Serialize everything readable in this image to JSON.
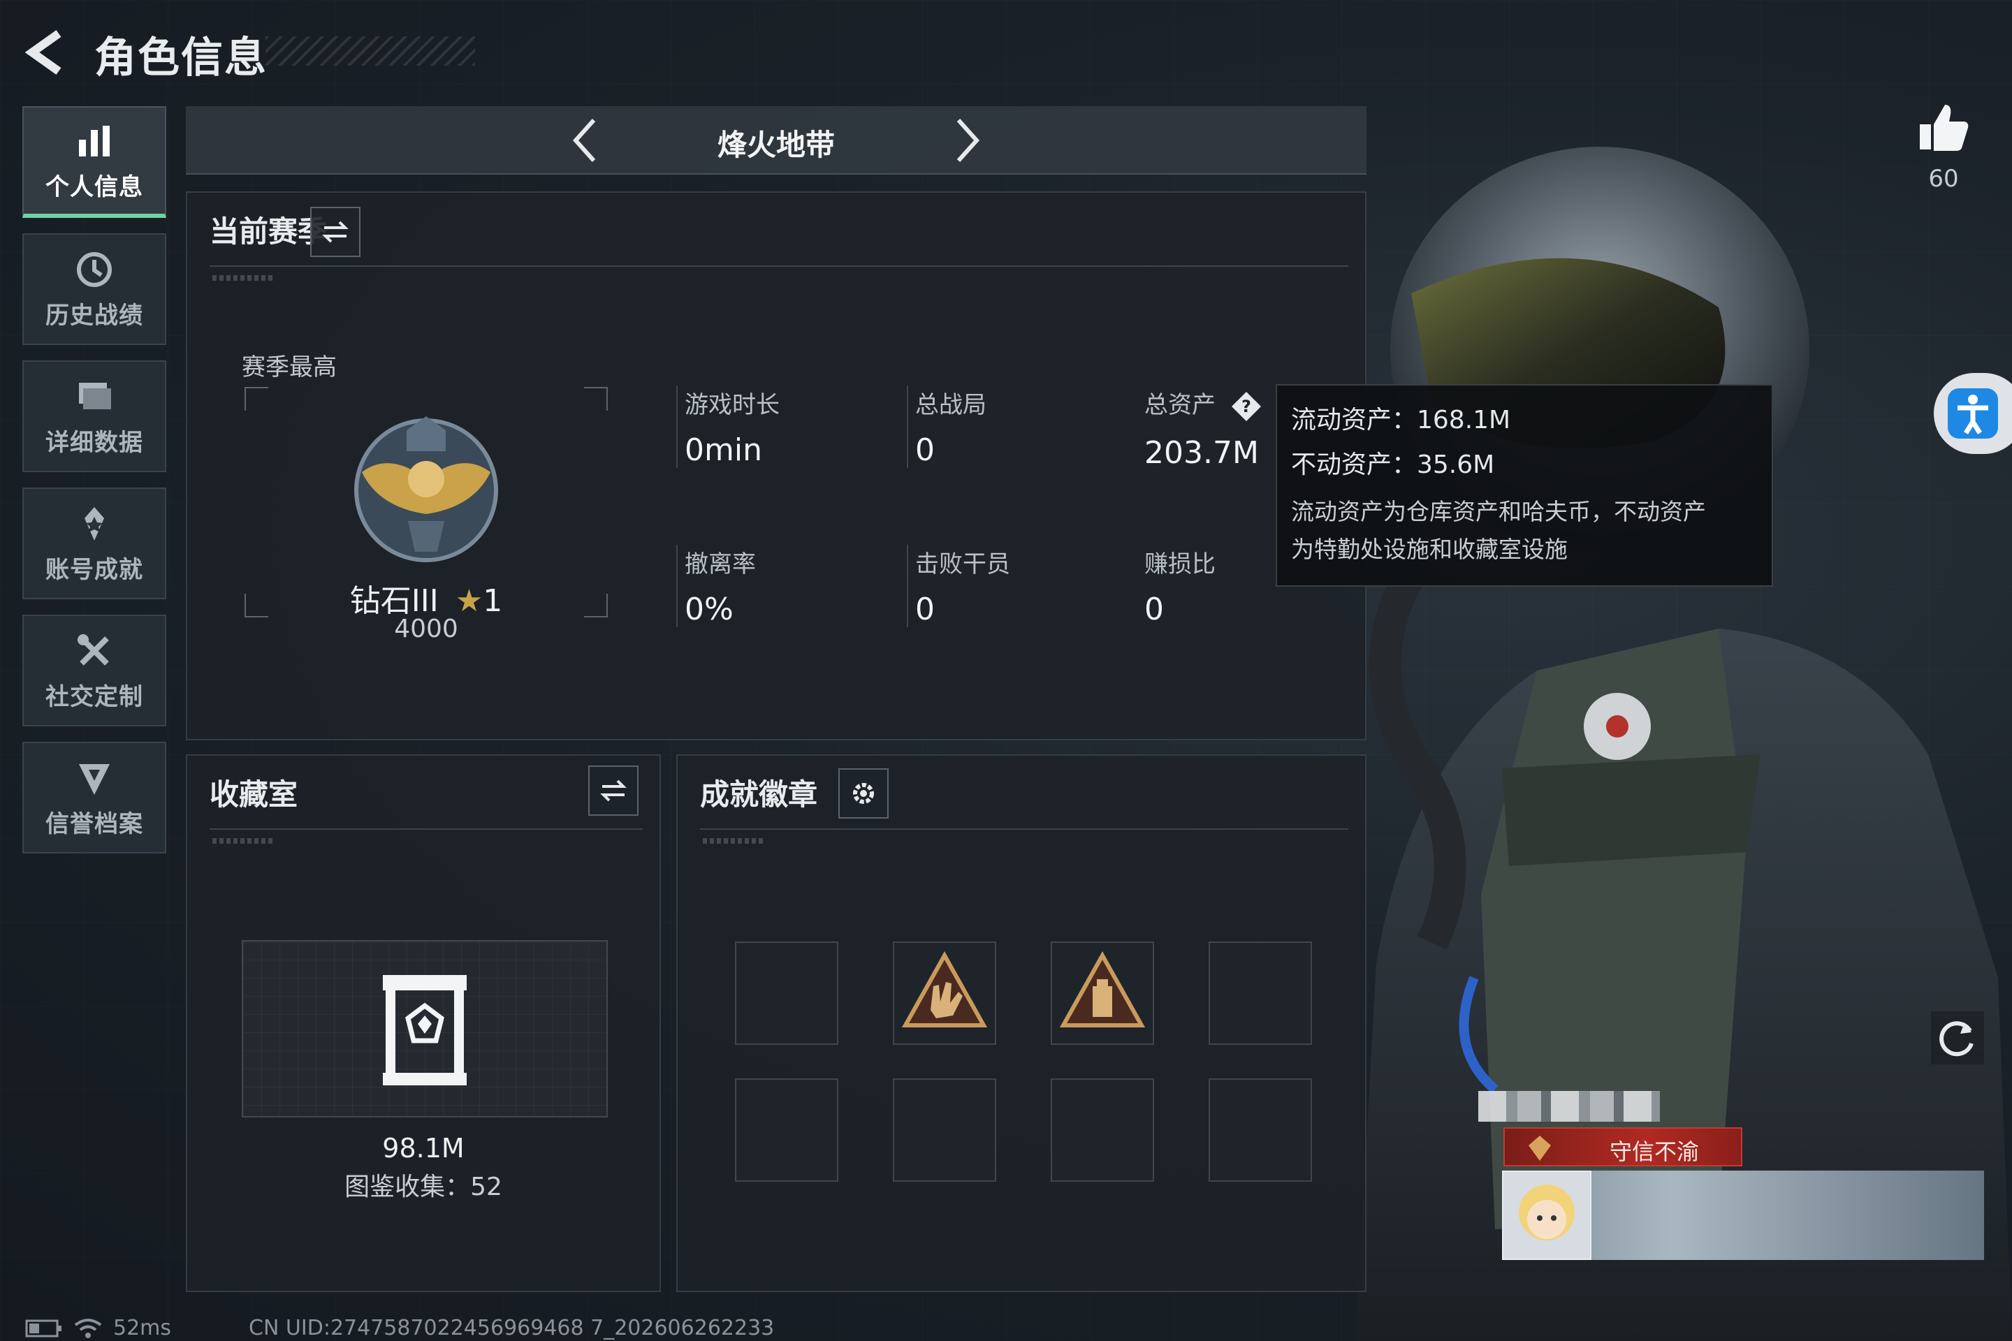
{
  "header": {
    "title": "角色信息"
  },
  "sidebar": {
    "items": [
      {
        "label": "个人信息",
        "icon": "bar-chart-icon",
        "active": true
      },
      {
        "label": "历史战绩",
        "icon": "history-clock-icon",
        "active": false
      },
      {
        "label": "详细数据",
        "icon": "folder-data-icon",
        "active": false
      },
      {
        "label": "账号成就",
        "icon": "achievement-star-icon",
        "active": false
      },
      {
        "label": "社交定制",
        "icon": "tools-wrench-icon",
        "active": false
      },
      {
        "label": "信誉档案",
        "icon": "shield-badge-icon",
        "active": false
      }
    ]
  },
  "mode": {
    "title": "烽火地带"
  },
  "season": {
    "header": "当前赛季",
    "best_label": "赛季最高",
    "rank_name": "钻石III",
    "rank_stars": "1",
    "rank_score": "4000",
    "stats": {
      "playtime": {
        "label": "游戏时长",
        "value": "0min"
      },
      "matches": {
        "label": "总战局",
        "value": "0"
      },
      "assets": {
        "label": "总资产",
        "value": "203.7M"
      },
      "extract_rate": {
        "label": "撤离率",
        "value": "0%"
      },
      "kills": {
        "label": "击败干员",
        "value": "0"
      },
      "profit_ratio": {
        "label": "赚损比",
        "value": "0"
      }
    }
  },
  "tooltip": {
    "liquid": "流动资产：168.1M",
    "fixed": "不动资产：35.6M",
    "desc_line1": "流动资产为仓库资产和哈夫币，不动资产",
    "desc_line2": "为特勤处设施和收藏室设施"
  },
  "collection": {
    "header": "收藏室",
    "value": "98.1M",
    "count_text": "图鉴收集：52"
  },
  "badges": {
    "header": "成就徽章"
  },
  "profile": {
    "likes": "60",
    "title_chip": "守信不渝"
  },
  "footer": {
    "ping": "52ms",
    "uid": "CN UID:2747587022456969468 7_202606262233"
  },
  "colors": {
    "accent_green": "#6fd4a3",
    "title_red": "#b02a22",
    "rank_gold": "#c9a24a"
  }
}
